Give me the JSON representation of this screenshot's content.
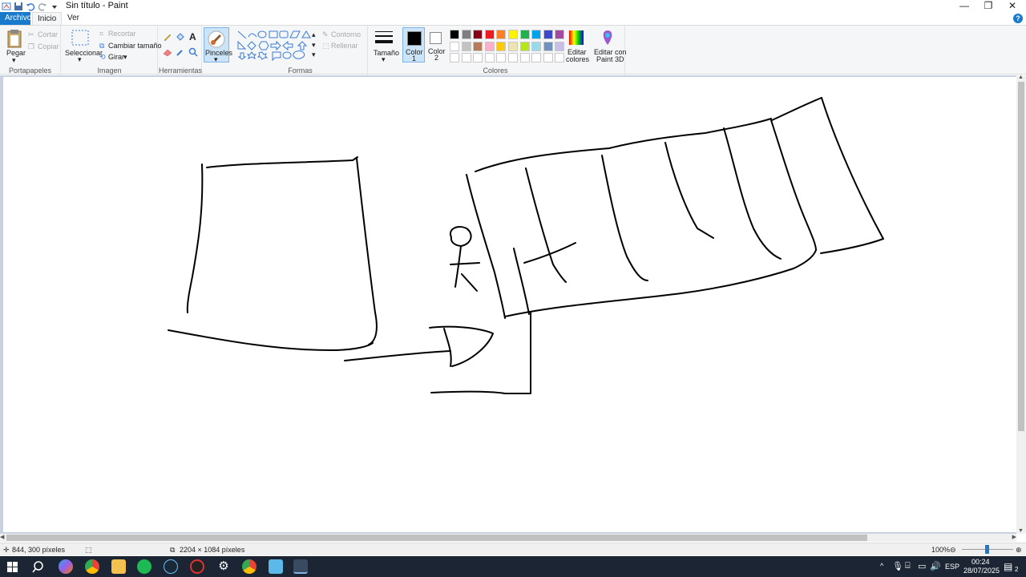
{
  "window": {
    "title": "Sin título - Paint",
    "quick_access_icons": [
      "save-icon",
      "undo-icon",
      "redo-icon",
      "customize-icon"
    ],
    "controls": [
      "minimize-icon",
      "restore-icon",
      "close-icon"
    ]
  },
  "menu": {
    "tabs": [
      "Archivo",
      "Inicio",
      "Ver"
    ],
    "active_tab": "Inicio",
    "help_label": "?"
  },
  "ribbon": {
    "clipboard": {
      "group_label": "Portapapeles",
      "paste": "Pegar",
      "cut": "Cortar",
      "copy": "Copiar"
    },
    "image": {
      "group_label": "Imagen",
      "select": "Seleccionar",
      "crop": "Recortar",
      "resize": "Cambiar tamaño",
      "rotate": "Girar"
    },
    "tools": {
      "group_label": "Herramientas",
      "icons": [
        "pencil-icon",
        "fill-icon",
        "text-icon",
        "eraser-icon",
        "color-picker-icon",
        "magnifier-icon"
      ]
    },
    "brushes": {
      "label": "Pinceles"
    },
    "shapes": {
      "group_label": "Formas",
      "outline": "Contorno",
      "fill": "Rellenar"
    },
    "size": {
      "label": "Tamaño"
    },
    "colors": {
      "group_label": "Colores",
      "color1_label": "Color\n1",
      "color1_name": "Color",
      "color1_num": "1",
      "color2_name": "Color",
      "color2_num": "2",
      "color1": "#000000",
      "color2": "#ffffff",
      "palette_row1": [
        "#000000",
        "#7f7f7f",
        "#880015",
        "#ed1c24",
        "#ff7f27",
        "#fff200",
        "#22b14c",
        "#00a2e8",
        "#3f48cc",
        "#a349a4"
      ],
      "palette_row2": [
        "#ffffff",
        "#c3c3c3",
        "#b97a57",
        "#ffaec9",
        "#ffc90e",
        "#efe4b0",
        "#b5e61d",
        "#99d9ea",
        "#7092be",
        "#c8bfe7"
      ],
      "palette_row3": [
        "#ffffff",
        "#ffffff",
        "#ffffff",
        "#ffffff",
        "#ffffff",
        "#ffffff",
        "#ffffff",
        "#ffffff",
        "#ffffff",
        "#ffffff"
      ],
      "edit_colors_line1": "Editar",
      "edit_colors_line2": "colores",
      "paint3d_line1": "Editar con",
      "paint3d_line2": "Paint 3D"
    }
  },
  "status": {
    "cursor_position": "844, 300 píxeles",
    "canvas_size": "2204 × 1084 píxeles",
    "zoom": "100%"
  },
  "taskbar": {
    "apps": [
      "windows-start-icon",
      "search-icon",
      "copilot-icon",
      "chrome-icon",
      "file-explorer-icon",
      "spotify-icon",
      "steam-icon",
      "app-icon",
      "settings-icon",
      "chrome-profile-icon",
      "notepad-icon",
      "paint-icon"
    ],
    "language": "ESP",
    "time": "00:24",
    "date": "28/07/2025",
    "notifications": "2"
  }
}
